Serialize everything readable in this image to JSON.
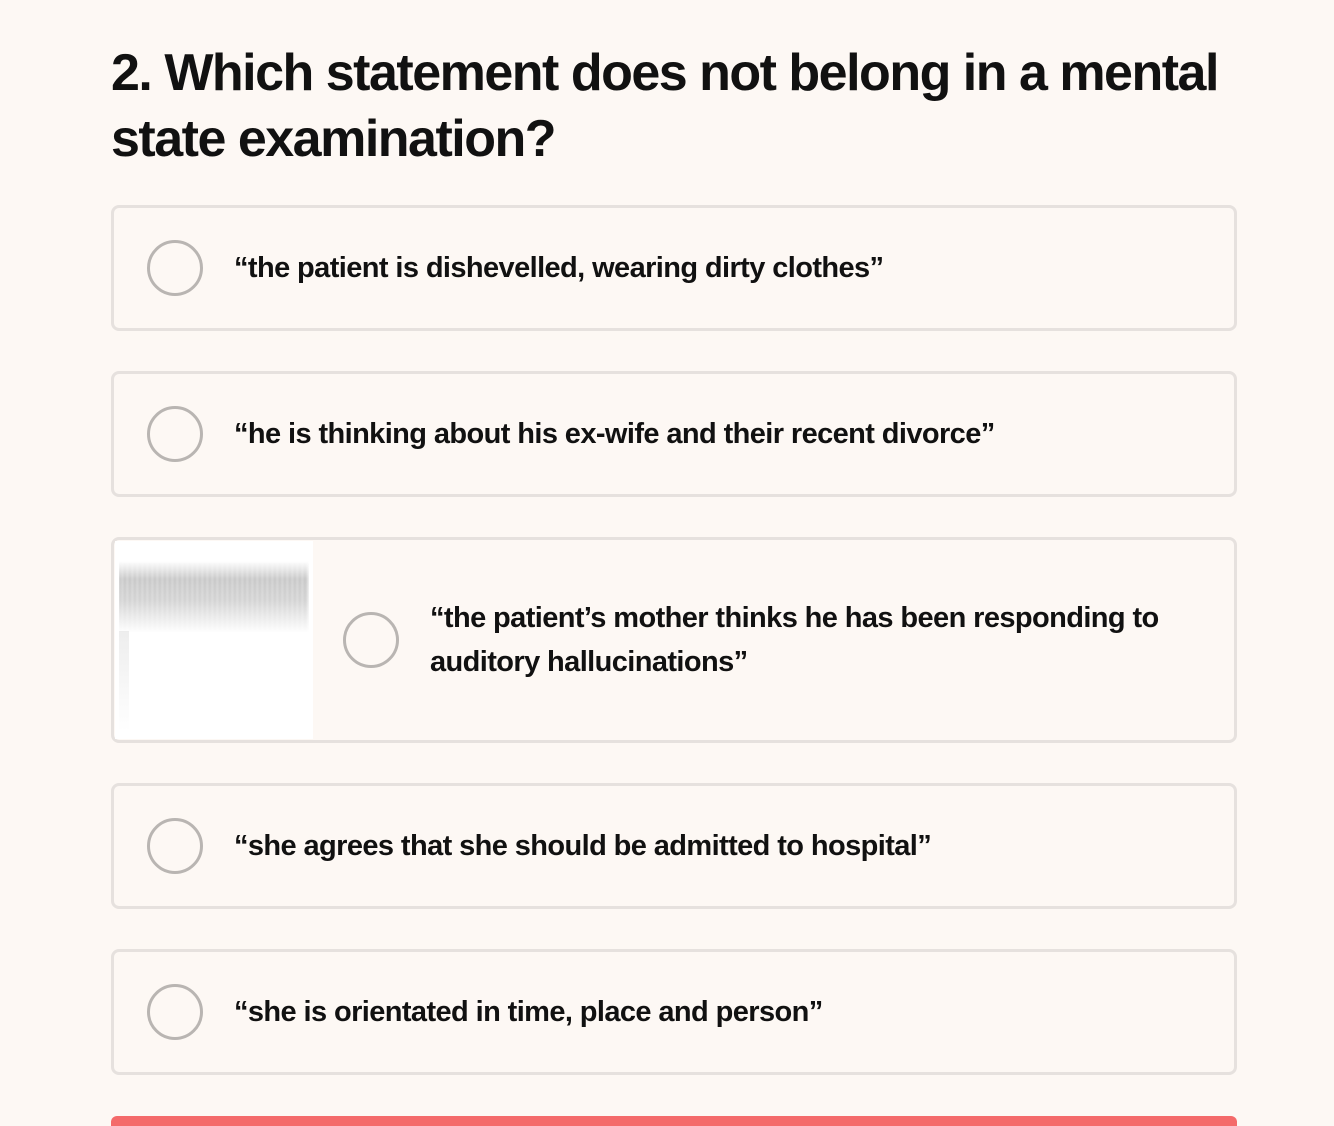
{
  "question": {
    "title": "2. Which statement does not belong in a mental state examination?"
  },
  "options": [
    {
      "label": "“the patient is dishevelled, wearing dirty clothes”",
      "selected": false
    },
    {
      "label": "“he is thinking about his ex-wife and their recent divorce”",
      "selected": false
    },
    {
      "label": "“the patient’s mother thinks he has been responding to auditory hallucinations”",
      "selected": false,
      "has_image": true
    },
    {
      "label": "“she agrees that she should be admitted to hospital”",
      "selected": false
    },
    {
      "label": "“she is orientated in time, place and person”",
      "selected": false
    }
  ],
  "colors": {
    "background": "#fdf8f4",
    "option_border": "#e6e1de",
    "radio_border": "#b9b5b2",
    "submit_accent": "#f46a6a",
    "text": "#111111"
  }
}
